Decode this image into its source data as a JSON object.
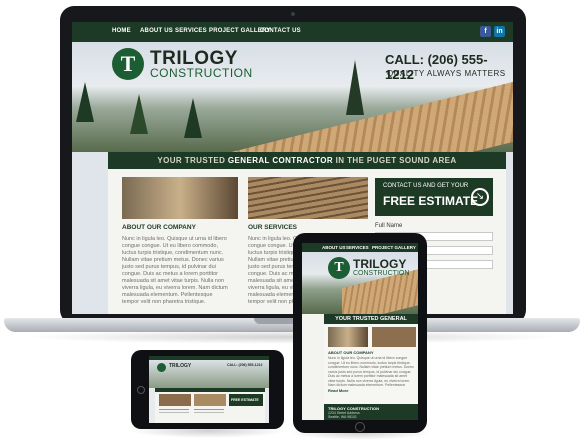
{
  "site": {
    "nav": [
      "HOME",
      "ABOUT US",
      "SERVICES",
      "PROJECT GALLERY",
      "CONTACT US"
    ],
    "social": [
      "f",
      "in"
    ],
    "logo_letter": "T",
    "logo_main": "TRILOGY",
    "logo_sub": "CONSTRUCTION",
    "call": "CALL: (206) 555-1212",
    "quality": "QUALITY ALWAYS MATTERS",
    "band_pre": "YOUR TRUSTED ",
    "band_strong": "GENERAL CONTRACTOR",
    "band_post": " IN THE PUGET SOUND AREA",
    "estimate_small": "CONTACT US AND GET YOUR",
    "estimate_big": "FREE ESTIMATE",
    "estimate_arrow": "↘",
    "about_heading": "ABOUT OUR COMPANY",
    "services_heading": "OUR SERVICES",
    "body_text": "Nunc in ligula leo. Quisque ut urna id libero congue congue. Ut eu libero commodo, luctus turpis tristique, condimentum nunc. Nullam vitae pretium metus. Donec varius justo sed purus tempus, id pulvinar dui congue. Duis ac metus a lorem porttitor malesuada sit amet vitae turpis. Nulla non viverra ligula, eu viverra lorem. Nam dictum malesuada elementum. Pellentesque tempor velit non pharetra tristique.",
    "form_label": "Full Name"
  },
  "tablet": {
    "nav": [
      "ABOUT US",
      "SERVICES",
      "PROJECT GALLERY"
    ],
    "band": "YOUR TRUSTED GENERAL",
    "about_heading": "ABOUT OUR COMPANY",
    "read_more": "Read More",
    "footer_title": "TRILOGY CONSTRUCTION",
    "footer_lines": [
      "1234 Street Address",
      "Seattle, WA 98101"
    ]
  },
  "phone": {
    "call": "CALL: (206) 555-1212",
    "estimate": "FREE ESTIMATE"
  },
  "colors": {
    "brand_green": "#1c3a25",
    "logo_green": "#1d5d33",
    "facebook": "#3b5998",
    "linkedin": "#0e76a8"
  }
}
